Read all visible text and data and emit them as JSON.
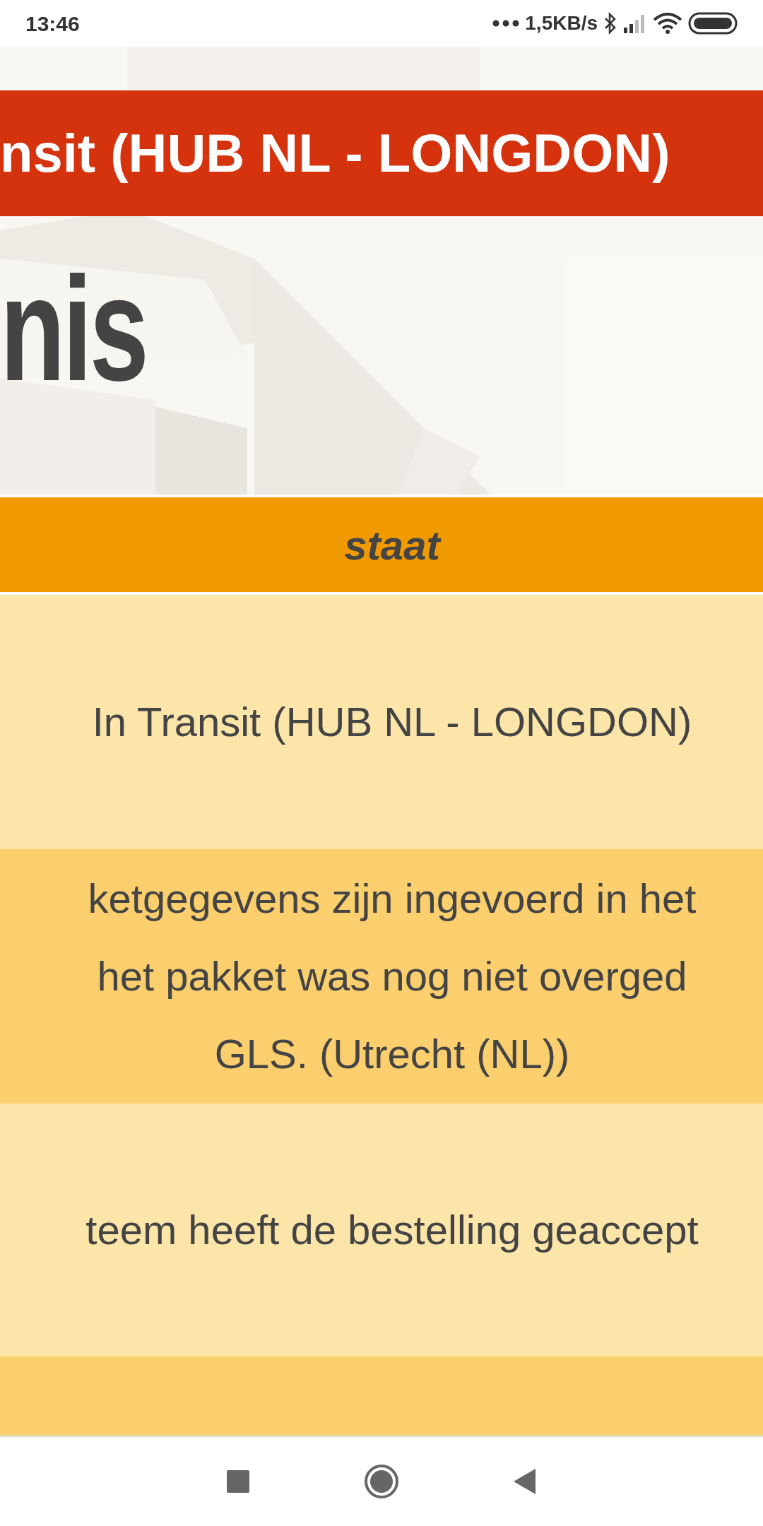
{
  "status_bar": {
    "time": "13:46",
    "network_speed": "1,5KB/s"
  },
  "banner": {
    "title": "nsit (HUB NL - LONGDON)"
  },
  "hero": {
    "heading": "nis"
  },
  "table": {
    "columns": [
      "staat"
    ],
    "rows": [
      {
        "lines": [
          "In Transit (HUB NL - LONGDON)"
        ]
      },
      {
        "lines": [
          "ketgegevens zijn ingevoerd in het",
          "het pakket was nog niet overged",
          "GLS. (Utrecht (NL))"
        ]
      },
      {
        "lines": [
          "teem heeft de bestelling geaccept"
        ]
      },
      {}
    ]
  }
}
